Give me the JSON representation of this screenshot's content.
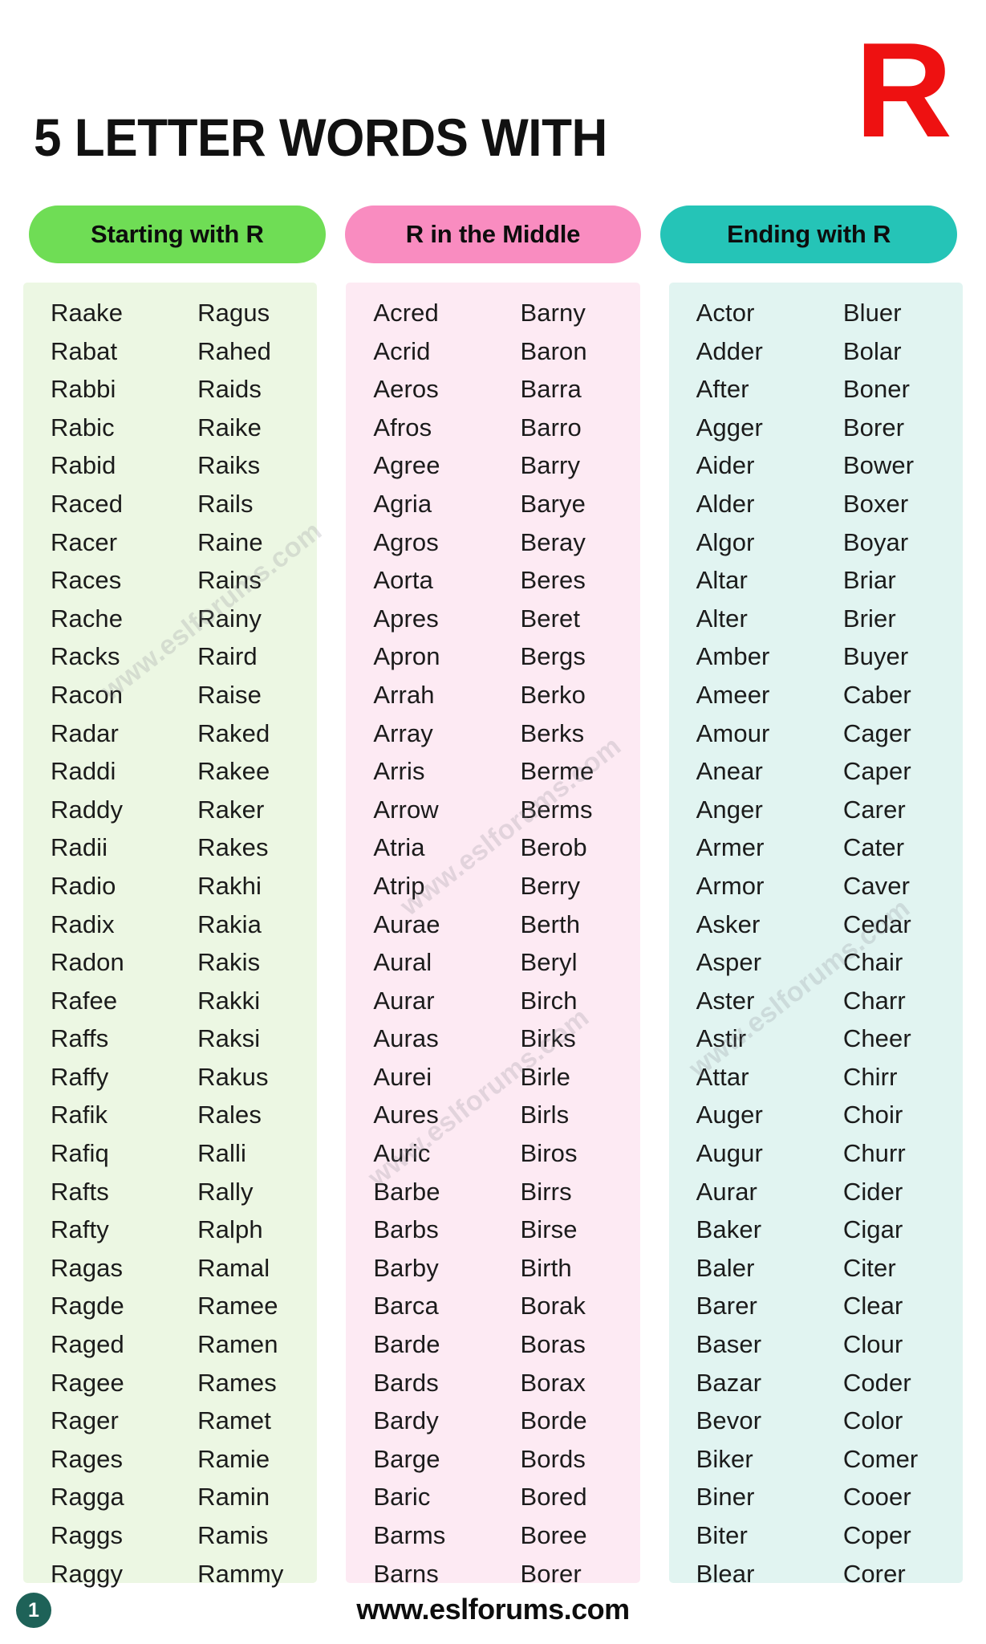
{
  "header": {
    "title": "5 LETTER WORDS WITH",
    "big_letter": "R",
    "big_letter_color": "#ee1111"
  },
  "sections": [
    {
      "badge_label": "Starting with R",
      "badge_color": "#6fdd55",
      "panel_color": "#ecf7e3",
      "left_words": [
        "Raake",
        "Rabat",
        "Rabbi",
        "Rabic",
        "Rabid",
        "Raced",
        "Racer",
        "Races",
        "Rache",
        "Racks",
        "Racon",
        "Radar",
        "Raddi",
        "Raddy",
        "Radii",
        "Radio",
        "Radix",
        "Radon",
        "Rafee",
        "Raffs",
        "Raffy",
        "Rafik",
        "Rafiq",
        "Rafts",
        "Rafty",
        "Ragas",
        "Ragde",
        "Raged",
        "Ragee",
        "Rager",
        "Rages",
        "Ragga",
        "Raggs",
        "Raggy"
      ],
      "right_words": [
        "Ragus",
        "Rahed",
        "Raids",
        "Raike",
        "Raiks",
        "Rails",
        "Raine",
        "Rains",
        "Rainy",
        "Raird",
        "Raise",
        "Raked",
        "Rakee",
        "Raker",
        "Rakes",
        "Rakhi",
        "Rakia",
        "Rakis",
        "Rakki",
        "Raksi",
        "Rakus",
        "Rales",
        "Ralli",
        "Rally",
        "Ralph",
        "Ramal",
        "Ramee",
        "Ramen",
        "Rames",
        "Ramet",
        "Ramie",
        "Ramin",
        "Ramis",
        "Rammy"
      ]
    },
    {
      "badge_label": "R in the Middle",
      "badge_color": "#f98cc0",
      "panel_color": "#fdeaf3",
      "left_words": [
        "Acred",
        "Acrid",
        "Aeros",
        "Afros",
        "Agree",
        "Agria",
        "Agros",
        "Aorta",
        "Apres",
        "Apron",
        "Arrah",
        "Array",
        "Arris",
        "Arrow",
        "Atria",
        "Atrip",
        "Aurae",
        "Aural",
        "Aurar",
        "Auras",
        "Aurei",
        "Aures",
        "Auric",
        "Barbe",
        "Barbs",
        "Barby",
        "Barca",
        "Barde",
        "Bards",
        "Bardy",
        "Barge",
        "Baric",
        "Barms",
        "Barns"
      ],
      "right_words": [
        "Barny",
        "Baron",
        "Barra",
        "Barro",
        "Barry",
        "Barye",
        "Beray",
        "Beres",
        "Beret",
        "Bergs",
        "Berko",
        "Berks",
        "Berme",
        "Berms",
        "Berob",
        "Berry",
        "Berth",
        "Beryl",
        "Birch",
        "Birks",
        "Birle",
        "Birls",
        "Biros",
        "Birrs",
        "Birse",
        "Birth",
        "Borak",
        "Boras",
        "Borax",
        "Borde",
        "Bords",
        "Bored",
        "Boree",
        "Borer"
      ]
    },
    {
      "badge_label": "Ending with R",
      "badge_color": "#25c4b7",
      "panel_color": "#e1f4f1",
      "left_words": [
        "Actor",
        "Adder",
        "After",
        "Agger",
        "Aider",
        "Alder",
        "Algor",
        "Altar",
        "Alter",
        "Amber",
        "Ameer",
        "Amour",
        "Anear",
        "Anger",
        "Armer",
        "Armor",
        "Asker",
        "Asper",
        "Aster",
        "Astir",
        "Attar",
        "Auger",
        "Augur",
        "Aurar",
        "Baker",
        "Baler",
        "Barer",
        "Baser",
        "Bazar",
        "Bevor",
        "Biker",
        "Biner",
        "Biter",
        "Blear"
      ],
      "right_words": [
        "Bluer",
        "Bolar",
        "Boner",
        "Borer",
        "Bower",
        "Boxer",
        "Boyar",
        "Briar",
        "Brier",
        "Buyer",
        "Caber",
        "Cager",
        "Caper",
        "Carer",
        "Cater",
        "Caver",
        "Cedar",
        "Chair",
        "Charr",
        "Cheer",
        "Chirr",
        "Choir",
        "Churr",
        "Cider",
        "Cigar",
        "Citer",
        "Clear",
        "Clour",
        "Coder",
        "Color",
        "Comer",
        "Cooer",
        "Coper",
        "Corer"
      ]
    }
  ],
  "watermarks": [
    "www.eslforums.com",
    "www.eslforums.com",
    "www.eslforums.com",
    "www.eslforums.com"
  ],
  "footer": {
    "page_number": "1",
    "site": "www.eslforums.com",
    "page_badge_color": "#1e6258"
  }
}
